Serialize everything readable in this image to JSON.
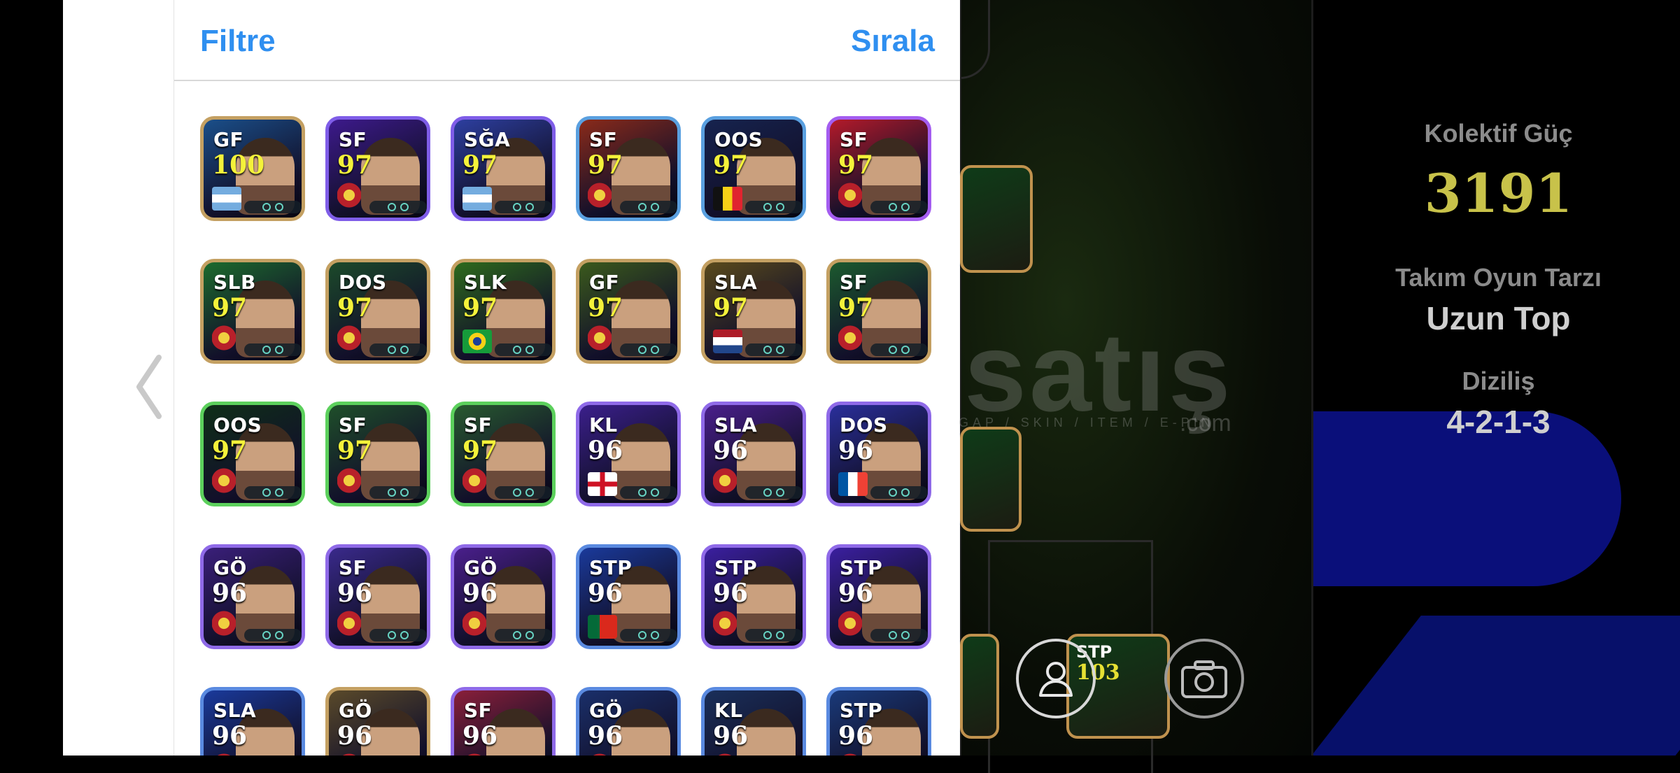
{
  "header": {
    "filter_label": "Filtre",
    "sort_label": "Sırala"
  },
  "rows": [
    [
      {
        "pos": "GF",
        "rating": "100",
        "frame": "#c4a062",
        "bg": "#1a4f8a",
        "badge": "flag-argentina"
      },
      {
        "pos": "SF",
        "rating": "97",
        "frame": "#7f5de8",
        "bg": "#3d1a8c",
        "badge": "club-crest"
      },
      {
        "pos": "SĞA",
        "rating": "97",
        "frame": "#7f5de8",
        "bg": "#2d3fa0",
        "badge": "flag-argentina"
      },
      {
        "pos": "SF",
        "rating": "97",
        "frame": "#5aa0e0",
        "bg": "#8a2a1a",
        "badge": "club-crest"
      },
      {
        "pos": "OOS",
        "rating": "97",
        "frame": "#5aa0e0",
        "bg": "#16234f",
        "badge": "flag-belgium"
      },
      {
        "pos": "SF",
        "rating": "97",
        "frame": "#a45df0",
        "bg": "#b41a2a",
        "badge": "club-crest"
      }
    ],
    [
      {
        "pos": "SLB",
        "rating": "97",
        "frame": "#c4a062",
        "bg": "#1d6b2d",
        "badge": "club-crest"
      },
      {
        "pos": "DOS",
        "rating": "97",
        "frame": "#c4a062",
        "bg": "#1c4a2a",
        "badge": "club-crest"
      },
      {
        "pos": "SLK",
        "rating": "97",
        "frame": "#c4a062",
        "bg": "#2e6b1c",
        "badge": "flag-brazil"
      },
      {
        "pos": "GF",
        "rating": "97",
        "frame": "#c4a062",
        "bg": "#3b5a1c",
        "badge": "club-crest"
      },
      {
        "pos": "SLA",
        "rating": "97",
        "frame": "#c4a062",
        "bg": "#5a4a1c",
        "badge": "flag-netherlands"
      },
      {
        "pos": "SF",
        "rating": "97",
        "frame": "#c4a062",
        "bg": "#1c5a2e",
        "badge": "club-crest"
      }
    ],
    [
      {
        "pos": "OOS",
        "rating": "97",
        "frame": "#5cd05c",
        "bg": "#0f2f18",
        "badge": "club-crest"
      },
      {
        "pos": "SF",
        "rating": "97",
        "frame": "#5cd05c",
        "bg": "#1f4f2a",
        "badge": "club-crest"
      },
      {
        "pos": "SF",
        "rating": "97",
        "frame": "#5cd05c",
        "bg": "#285a2f",
        "badge": "club-crest"
      },
      {
        "pos": "KL",
        "rating": "96",
        "frame": "#8f6ae8",
        "bg": "#3b1f8c",
        "badge": "flag-england"
      },
      {
        "pos": "SLA",
        "rating": "96",
        "frame": "#8f6ae8",
        "bg": "#4a1f8c",
        "badge": "club-crest"
      },
      {
        "pos": "DOS",
        "rating": "96",
        "frame": "#8f6ae8",
        "bg": "#2a2f9c",
        "badge": "flag-france"
      }
    ],
    [
      {
        "pos": "GÖ",
        "rating": "96",
        "frame": "#8f6ae8",
        "bg": "#3a1f7a",
        "badge": "club-crest"
      },
      {
        "pos": "SF",
        "rating": "96",
        "frame": "#8f6ae8",
        "bg": "#3a2a8c",
        "badge": "club-crest"
      },
      {
        "pos": "GÖ",
        "rating": "96",
        "frame": "#8f6ae8",
        "bg": "#4a1f8c",
        "badge": "club-crest"
      },
      {
        "pos": "STP",
        "rating": "96",
        "frame": "#5a8ae0",
        "bg": "#1a3a9c",
        "badge": "flag-portugal"
      },
      {
        "pos": "STP",
        "rating": "96",
        "frame": "#8f6ae8",
        "bg": "#3b1fa0",
        "badge": "club-crest"
      },
      {
        "pos": "STP",
        "rating": "96",
        "frame": "#8f6ae8",
        "bg": "#3b1fa0",
        "badge": "club-crest"
      }
    ],
    [
      {
        "pos": "SLA",
        "rating": "96",
        "frame": "#5a8ae0",
        "bg": "#1a3a9c",
        "badge": "club-crest"
      },
      {
        "pos": "GÖ",
        "rating": "96",
        "frame": "#c4a062",
        "bg": "#5a4a2a",
        "badge": "club-crest"
      },
      {
        "pos": "SF",
        "rating": "96",
        "frame": "#8f6ae8",
        "bg": "#8a1f3a",
        "badge": "club-crest"
      },
      {
        "pos": "GÖ",
        "rating": "96",
        "frame": "#5a8ae0",
        "bg": "#1a2f6a",
        "badge": "club-crest"
      },
      {
        "pos": "KL",
        "rating": "96",
        "frame": "#5a8ae0",
        "bg": "#1a2f5a",
        "badge": "club-crest"
      },
      {
        "pos": "STP",
        "rating": "96",
        "frame": "#5a8ae0",
        "bg": "#1a3a7a",
        "badge": "club-crest"
      }
    ]
  ],
  "team": {
    "power_label": "Kolektif Güç",
    "power_value": "3191",
    "style_label": "Takım Oyun Tarzı",
    "style_value": "Uzun Top",
    "formation_label": "Diziliş",
    "formation_value": "4-2-1-3"
  },
  "watermark": {
    "main": "satış",
    "sub": "GAP / SKIN / ITEM / E-PIN",
    "com": ".com"
  },
  "field_cards": [
    {
      "pos": "",
      "rating": ""
    },
    {
      "pos": "",
      "rating": ""
    },
    {
      "pos": "STP",
      "rating": "103"
    }
  ],
  "colors": {
    "accent": "#2f8ff0",
    "power": "#c8c24a",
    "rating_yellow": "#f4f23a",
    "rating_white": "#ffffff"
  },
  "icons": {
    "back": "chevron-left-icon",
    "profile": "person-icon",
    "camera": "camera-icon"
  }
}
